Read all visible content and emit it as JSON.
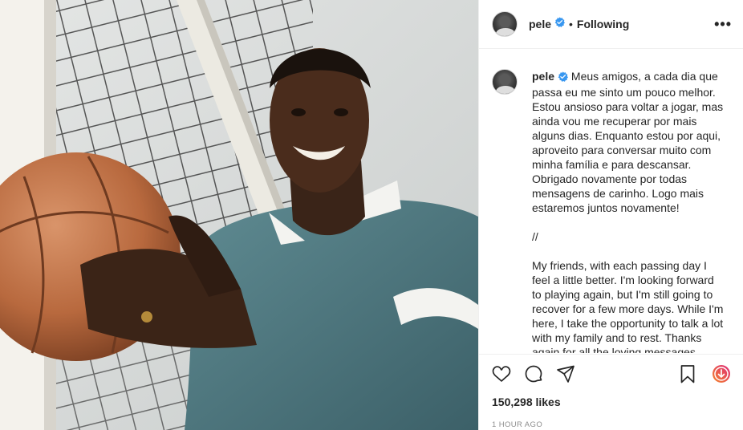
{
  "post": {
    "photo_alt": "",
    "header": {
      "username": "pele",
      "separator": "•",
      "follow_status": "Following",
      "more_glyph": "•••"
    },
    "caption": {
      "username": "pele",
      "text": "Meus amigos, a cada dia que passa eu me sinto um pouco melhor. Estou ansioso para voltar a jogar, mas ainda vou me recuperar por mais alguns dias. Enquanto estou por aqui, aproveito para conversar muito com minha família e para descansar. Obrigado novamente por todas mensagens de carinho. Logo mais estaremos juntos novamente!\n\n//\n\nMy friends, with each passing day I feel a little better. I'm looking forward to playing again, but I'm still going to recover for a few more days. While I'm here, I take the opportunity to talk a lot with my family and to rest. Thanks again for all the loving messages. We'll be together again soon!"
    },
    "likes": "150,298 likes",
    "timestamp": "1 HOUR AGO",
    "icons": {
      "like": "heart-icon",
      "comment": "comment-icon",
      "share": "share-icon",
      "save": "bookmark-icon",
      "igtv": "download-circle-icon",
      "verified": "verified-badge-icon"
    },
    "colors": {
      "verified_blue": "#3897f0",
      "text": "#262626",
      "muted": "#8e8e8e",
      "igtv_gradient_start": "#f58529",
      "igtv_gradient_end": "#dd2a7b"
    }
  }
}
